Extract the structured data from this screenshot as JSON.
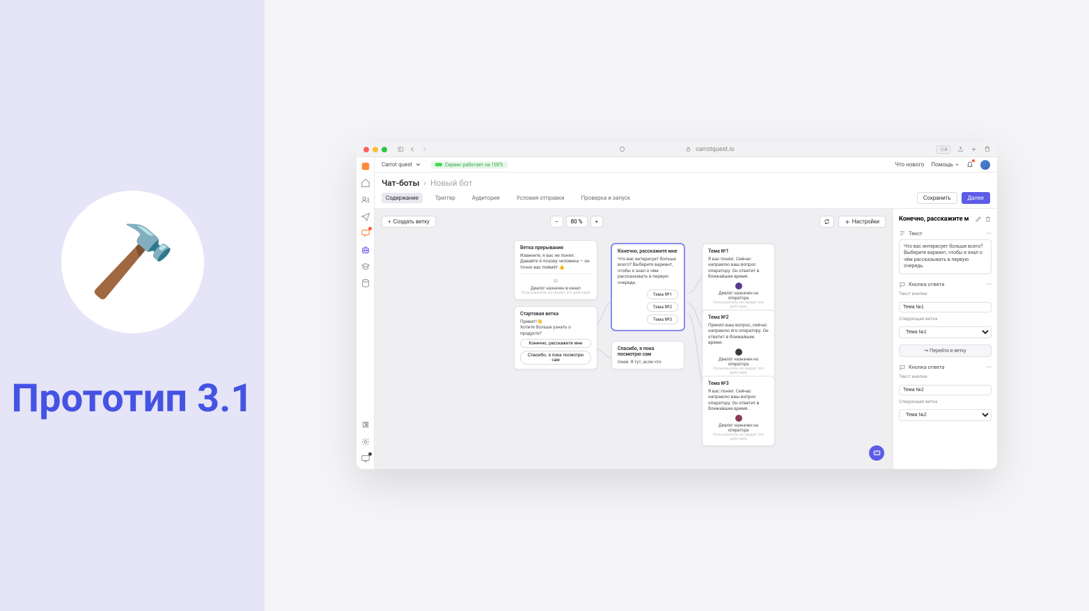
{
  "left": {
    "hammer": "🔨",
    "title": "Прототип 3.1"
  },
  "browser": {
    "url": "carrotquest.io"
  },
  "topbar": {
    "app_name": "Carrot quest",
    "status": "Сервис работает на 100%",
    "whats_new": "Что нового",
    "help": "Помощь"
  },
  "breadcrumb": {
    "root": "Чат-боты",
    "current": "Новый бот"
  },
  "tabs": {
    "content": "Содержание",
    "trigger": "Триггер",
    "audience": "Аудитория",
    "conditions": "Условия отправки",
    "check": "Проверка и запуск",
    "save": "Сохранить",
    "next": "Далее"
  },
  "canvas": {
    "create_branch": "Создать ветку",
    "zoom": "80 %",
    "settings": "Настройки"
  },
  "nodes": {
    "interrupt": {
      "title": "Ветка прерывания",
      "text": "Извините, я вас не понял. Давайте я позову человека — он точно вас поймёт 👍",
      "footer": "Диалог назначен в канал",
      "footer_sub": "Пользователь не увидит это действие"
    },
    "start": {
      "title": "Стартовая ветка",
      "text": "Привет!👋\nХотите больше узнать о продукте?",
      "btn1": "Конечно, расскажите мне",
      "btn2": "Спасибо, я пока посмотрю сам"
    },
    "tell": {
      "title": "Конечно, расскажите мне",
      "text": "Что вас интересует больше всего? Выберите вариант, чтобы я знал о чём рассказывать в первую очередь.",
      "c1": "Тема №1",
      "c2": "Тема №2",
      "c3": "Тема №3"
    },
    "self": {
      "title": "Спасибо, я пока посмотрю сам",
      "text": "Окей. Я тут, если что"
    },
    "t1": {
      "title": "Тема №1",
      "text": "Я вас понял. Сейчас направлю ваш вопрос оператору. Он ответит в ближайшее время.",
      "footer": "Диалог назначен на оператора",
      "footer_sub": "Пользователь не увидит это действие"
    },
    "t2": {
      "title": "Тема №2",
      "text": "Принял ваш вопрос, сейчас направлю его оператору. Он ответит в ближайшее время.",
      "footer": "Диалог назначен на оператора",
      "footer_sub": "Пользователь не увидит это действие"
    },
    "t3": {
      "title": "Тема №3",
      "text": "Я вас понял. Сейчас направлю ваш вопрос оператору. Он ответит в ближайшее время.",
      "footer": "Диалог назначен на оператора",
      "footer_sub": "Пользователь не увидит это действие"
    }
  },
  "panel": {
    "title": "Конечно, расскажите м",
    "text_section": "Текст",
    "text_body": "Что вас интересует больше всего? Выберите вариант, чтобы я знал о чём рассказывать в первую очередь.",
    "answer_section": "Кнопка ответа",
    "btn_text_label": "Текст кнопки",
    "next_branch_label": "Следующая ветка",
    "go_branch": "Перейти в ветку",
    "a1_text": "Тема №1",
    "a1_next": "Тема №1",
    "a2_text": "Тема №2",
    "a2_next": "Тема №2"
  }
}
